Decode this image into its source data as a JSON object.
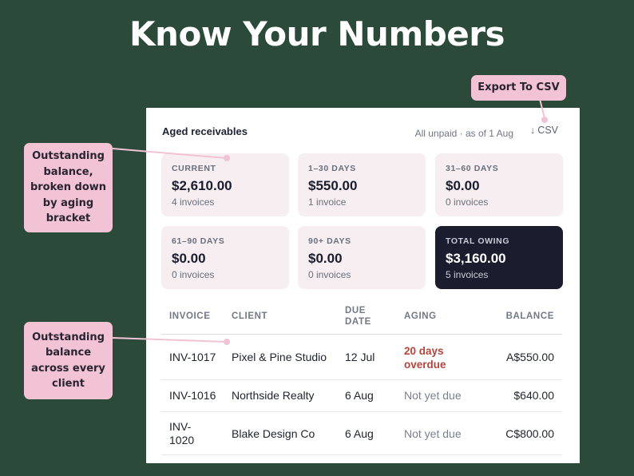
{
  "headline": "Know Your Numbers",
  "callouts": {
    "export": "Export To CSV",
    "balance_by_aging": "Outstanding balance, broken down by aging bracket",
    "balance_by_client": "Outstanding balance across every client"
  },
  "card": {
    "title": "Aged receivables",
    "meta": "All unpaid · as of 1 Aug",
    "csv_label": "CSV",
    "csv_icon": "arrow-down-icon"
  },
  "tiles": [
    {
      "label": "CURRENT",
      "amount": "$2,610.00",
      "count": "4 invoices"
    },
    {
      "label": "1–30 DAYS",
      "amount": "$550.00",
      "count": "1 invoice"
    },
    {
      "label": "31–60 DAYS",
      "amount": "$0.00",
      "count": "0 invoices"
    },
    {
      "label": "61–90 DAYS",
      "amount": "$0.00",
      "count": "0 invoices"
    },
    {
      "label": "90+ DAYS",
      "amount": "$0.00",
      "count": "0 invoices"
    },
    {
      "label": "TOTAL OWING",
      "amount": "$3,160.00",
      "count": "5 invoices"
    }
  ],
  "table": {
    "headers": {
      "invoice": "INVOICE",
      "client": "CLIENT",
      "due_date_1": "DUE",
      "due_date_2": "DATE",
      "aging": "AGING",
      "balance": "BALANCE"
    },
    "rows": [
      {
        "invoice": "INV-1017",
        "client": "Pixel & Pine Studio",
        "due": "12 Jul",
        "aging_1": "20 days",
        "aging_2": "overdue",
        "balance": "A$550.00"
      },
      {
        "invoice": "INV-1016",
        "client": "Northside Realty",
        "due": "6 Aug",
        "aging": "Not yet due",
        "balance": "$640.00"
      },
      {
        "invoice_1": "INV-",
        "invoice_2": "1020",
        "client": "Blake Design Co",
        "due": "6 Aug",
        "aging": "Not yet due",
        "balance": "C$800.00"
      }
    ]
  },
  "colors": {
    "background": "#2b4a3a",
    "callout": "#f1c3d4",
    "tile": "#f6eef0",
    "total_tile": "#1b1d2e",
    "overdue": "#b3463c"
  }
}
